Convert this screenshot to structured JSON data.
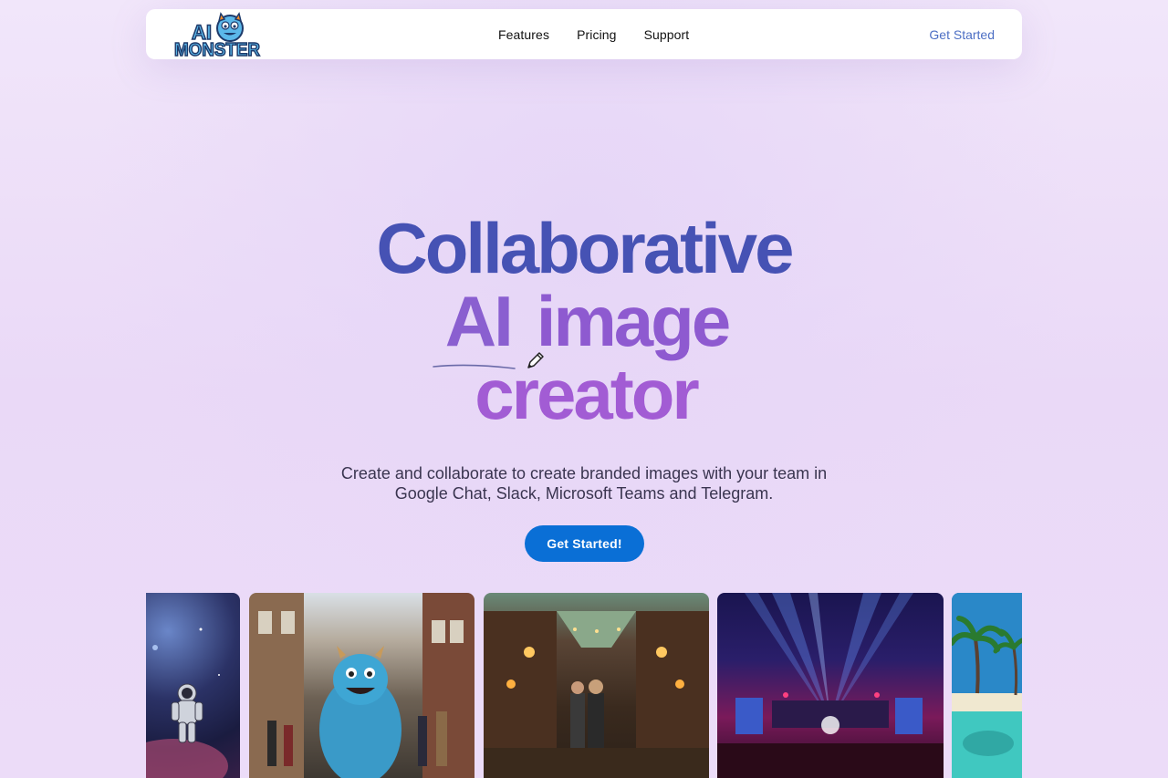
{
  "nav": {
    "logo_text_top": "AI",
    "logo_text_bottom": "MONSTER",
    "links": [
      "Features",
      "Pricing",
      "Support"
    ],
    "cta_label": "Get Started"
  },
  "hero": {
    "title_line1": "Collaborative",
    "title_line2_word1": "AI",
    "title_line2_word2": "image",
    "title_line3": "creator",
    "subtitle_line1": "Create and collaborate to create branded images with your team in",
    "subtitle_line2": "Google Chat, Slack, Microsoft Teams and Telegram.",
    "cta_label": "Get Started!"
  },
  "gallery": {
    "images": [
      {
        "name": "astronaut-space-image"
      },
      {
        "name": "blue-monster-street-image"
      },
      {
        "name": "market-lanterns-image"
      },
      {
        "name": "concert-stage-lights-image"
      },
      {
        "name": "tropical-beach-palms-image"
      }
    ]
  },
  "colors": {
    "accent": "#0a6fd6",
    "title_blue": "#4652b4",
    "title_purple": "#a25cd4",
    "nav_cta": "#4d6fc4"
  }
}
